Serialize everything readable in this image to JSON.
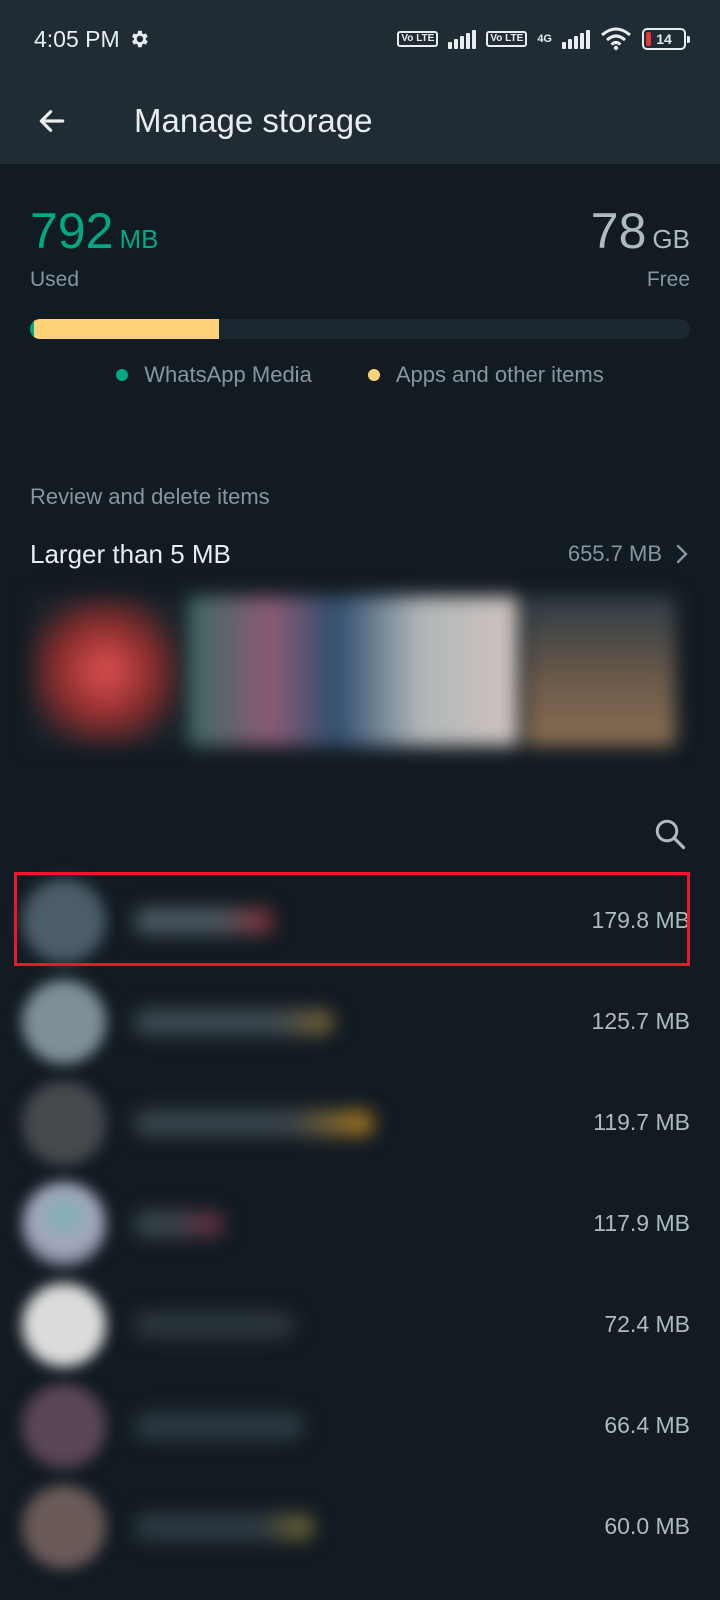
{
  "status": {
    "time": "4:05 PM",
    "sim1_badge": "Vo LTE",
    "sim2_badge": "Vo LTE",
    "network": "4G",
    "battery": "14"
  },
  "header": {
    "title": "Manage storage"
  },
  "summary": {
    "used_value": "792",
    "used_unit": "MB",
    "used_label": "Used",
    "free_value": "78",
    "free_unit": "GB",
    "free_label": "Free",
    "whatsapp_fraction": 0.006,
    "apps_fraction": 0.28,
    "legend": [
      {
        "label": "WhatsApp Media",
        "color": "#00a884"
      },
      {
        "label": "Apps and other items",
        "color": "#ffd279"
      }
    ]
  },
  "review": {
    "heading": "Review and delete items",
    "larger_title": "Larger than 5 MB",
    "larger_size": "655.7 MB"
  },
  "chats": [
    {
      "size": "179.8 MB",
      "highlighted": true
    },
    {
      "size": "125.7 MB",
      "highlighted": false
    },
    {
      "size": "119.7 MB",
      "highlighted": false
    },
    {
      "size": "117.9 MB",
      "highlighted": false
    },
    {
      "size": "72.4 MB",
      "highlighted": false
    },
    {
      "size": "66.4 MB",
      "highlighted": false
    },
    {
      "size": "60.0 MB",
      "highlighted": false
    }
  ],
  "colors": {
    "accent": "#00a884",
    "apps": "#ffd279",
    "highlight": "#e8192c",
    "background": "#111b21",
    "appbar": "#1f2c34"
  }
}
